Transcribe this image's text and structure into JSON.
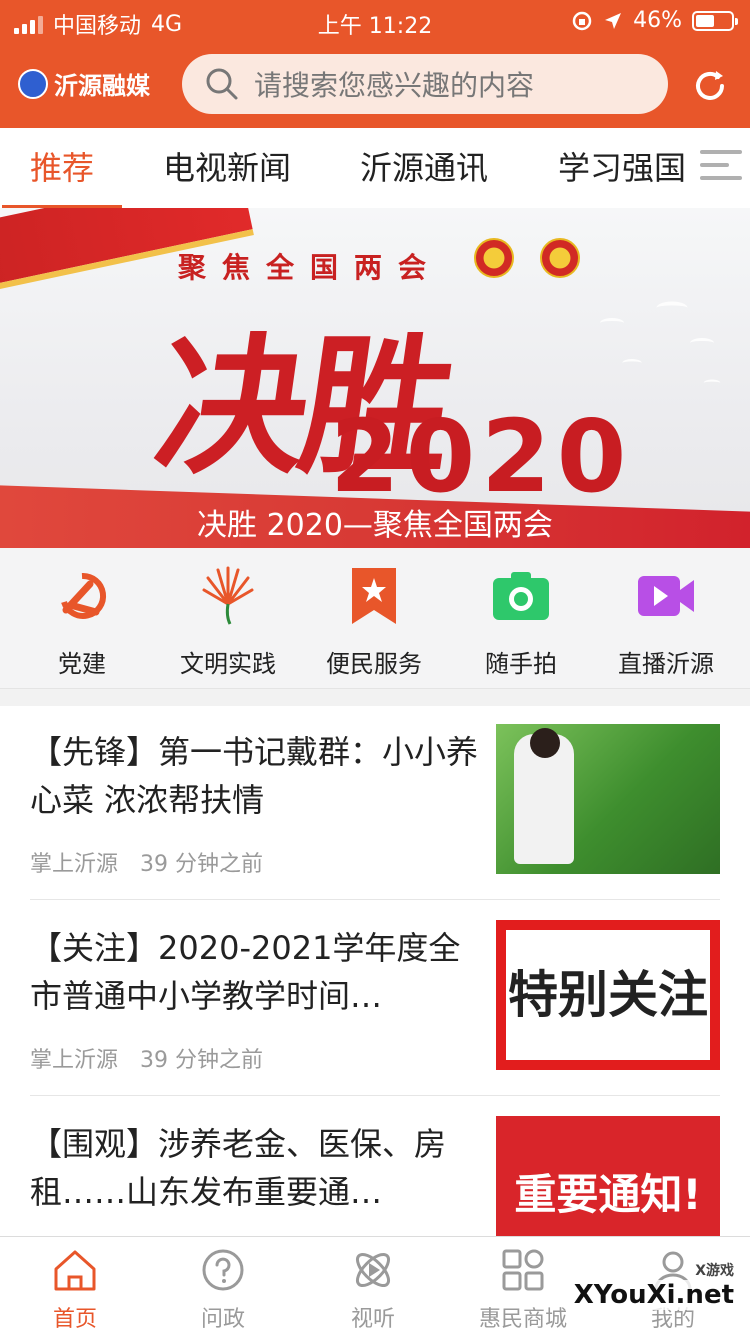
{
  "status": {
    "carrier": "中国移动",
    "network": "4G",
    "time": "上午 11:22",
    "battery": "46%"
  },
  "appbar": {
    "logo_text": "沂源融媒",
    "search_placeholder": "请搜索您感兴趣的内容"
  },
  "tabs": [
    {
      "label": "推荐",
      "active": true
    },
    {
      "label": "电视新闻"
    },
    {
      "label": "沂源通讯"
    },
    {
      "label": "学习强国"
    }
  ],
  "banner": {
    "headline_small": "聚焦全国两会",
    "headline_big": "决胜",
    "headline_year": "2020",
    "caption": "决胜 2020—聚焦全国两会"
  },
  "quick_entries": [
    {
      "label": "党建",
      "icon": "party-icon"
    },
    {
      "label": "文明实践",
      "icon": "flower-icon"
    },
    {
      "label": "便民服务",
      "icon": "bookmark-star-icon"
    },
    {
      "label": "随手拍",
      "icon": "camera-icon"
    },
    {
      "label": "直播沂源",
      "icon": "video-icon"
    }
  ],
  "news": [
    {
      "title": "【先锋】第一书记戴群：小小养心菜 浓浓帮扶情",
      "source": "掌上沂源",
      "time": "39 分钟之前"
    },
    {
      "title": "【关注】2020-2021学年度全市普通中小学教学时间…",
      "source": "掌上沂源",
      "time": "39 分钟之前",
      "thumb_text": "特别关注"
    },
    {
      "title": "【围观】涉养老金、医保、房租……山东发布重要通…",
      "thumb_text": "重要通知!"
    }
  ],
  "bottom_nav": [
    {
      "label": "首页",
      "active": true
    },
    {
      "label": "问政"
    },
    {
      "label": "视听"
    },
    {
      "label": "惠民商城"
    },
    {
      "label": "我的"
    }
  ],
  "watermark": {
    "text": "XYouXi.net",
    "small": "X游戏"
  },
  "colors": {
    "brand": "#e8562a",
    "banner_red": "#cc1f24"
  }
}
